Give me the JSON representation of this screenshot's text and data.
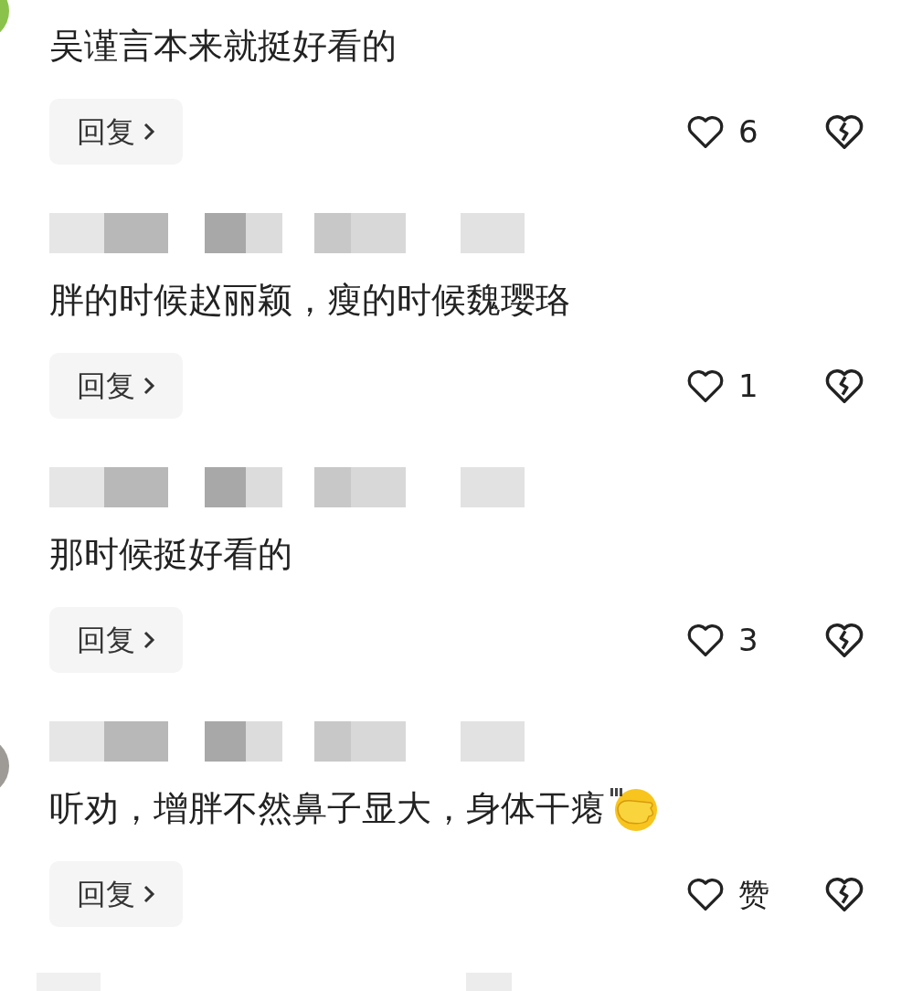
{
  "comments": [
    {
      "header_shown": false,
      "avatar": {
        "color": "#8bc34a"
      },
      "text": "吴谨言本来就挺好看的",
      "emoji": false,
      "reply": "回复",
      "like_count": "6"
    },
    {
      "header_shown": true,
      "text": "胖的时候赵丽颖，瘦的时候魏璎珞",
      "emoji": false,
      "reply": "回复",
      "like_count": "1"
    },
    {
      "header_shown": true,
      "text": "那时候挺好看的",
      "emoji": false,
      "reply": "回复",
      "like_count": "3"
    },
    {
      "header_shown": true,
      "avatar": {
        "color": "#9e9a96"
      },
      "text": "听劝，增胖不然鼻子显大，身体干瘪",
      "emoji": true,
      "reply": "回复",
      "like_count": "赞"
    }
  ],
  "more_below": true
}
